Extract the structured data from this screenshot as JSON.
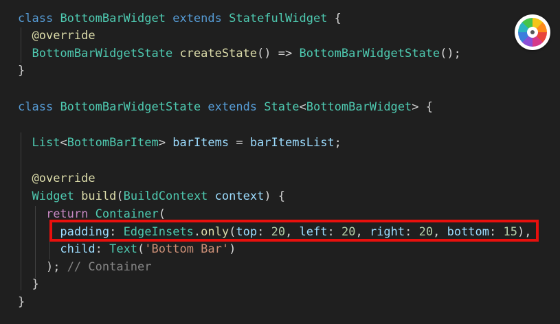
{
  "code": {
    "l1": {
      "kw_class": "class",
      "name": "BottomBarWidget",
      "kw_extends": "extends",
      "parent": "StatefulWidget",
      "brace": " {"
    },
    "l2": {
      "annotation": "@override"
    },
    "l3": {
      "type": "BottomBarWidgetState",
      "method": "createState",
      "arrow": "() => ",
      "ctor": "BottomBarWidgetState",
      "end": "();"
    },
    "l4": {
      "brace": "}"
    },
    "l5": {
      "kw_class": "class",
      "name": "BottomBarWidgetState",
      "kw_extends": "extends",
      "parent": "State",
      "lt": "<",
      "generic": "BottomBarWidget",
      "gt_brace": "> {"
    },
    "l6": {
      "type": "List",
      "lt": "<",
      "generic": "BottomBarItem",
      "gt": "> ",
      "var": "barItems",
      "eq": " = ",
      "value": "barItemsList",
      "semi": ";"
    },
    "l7": {
      "annotation": "@override"
    },
    "l8": {
      "type": "Widget",
      "method": "build",
      "paren_open": "(",
      "param_type": "BuildContext",
      "param": "context",
      "paren_close_brace": ") {"
    },
    "l9": {
      "kw_return": "return",
      "cls": "Container",
      "paren": "("
    },
    "l10": {
      "prop": "padding",
      "colon": ": ",
      "cls": "EdgeInsets",
      "dot": ".",
      "method": "only",
      "open": "(",
      "a1": "top",
      "v1": "20",
      "a2": "left",
      "v2": "20",
      "a3": "right",
      "v3": "20",
      "a4": "bottom",
      "v4": "15",
      "close": "),"
    },
    "l11": {
      "prop": "child",
      "colon": ": ",
      "cls": "Text",
      "open": "(",
      "str": "'Bottom Bar'",
      "close": ")"
    },
    "l12": {
      "close": ");",
      "comment": "// Container"
    },
    "l13": {
      "brace": "}"
    },
    "l14": {
      "brace": "}"
    }
  },
  "colors": {
    "background": "#1f1f1f",
    "keyword": "#569cd6",
    "class": "#4ec9b0",
    "function": "#dcdcaa",
    "variable": "#9cdcfe",
    "number": "#b5cea8",
    "string": "#ce9178",
    "control": "#c586c0",
    "comment": "#858585",
    "highlight_border": "#e8100d"
  },
  "logo": {
    "icon": "color-wheel-icon"
  }
}
